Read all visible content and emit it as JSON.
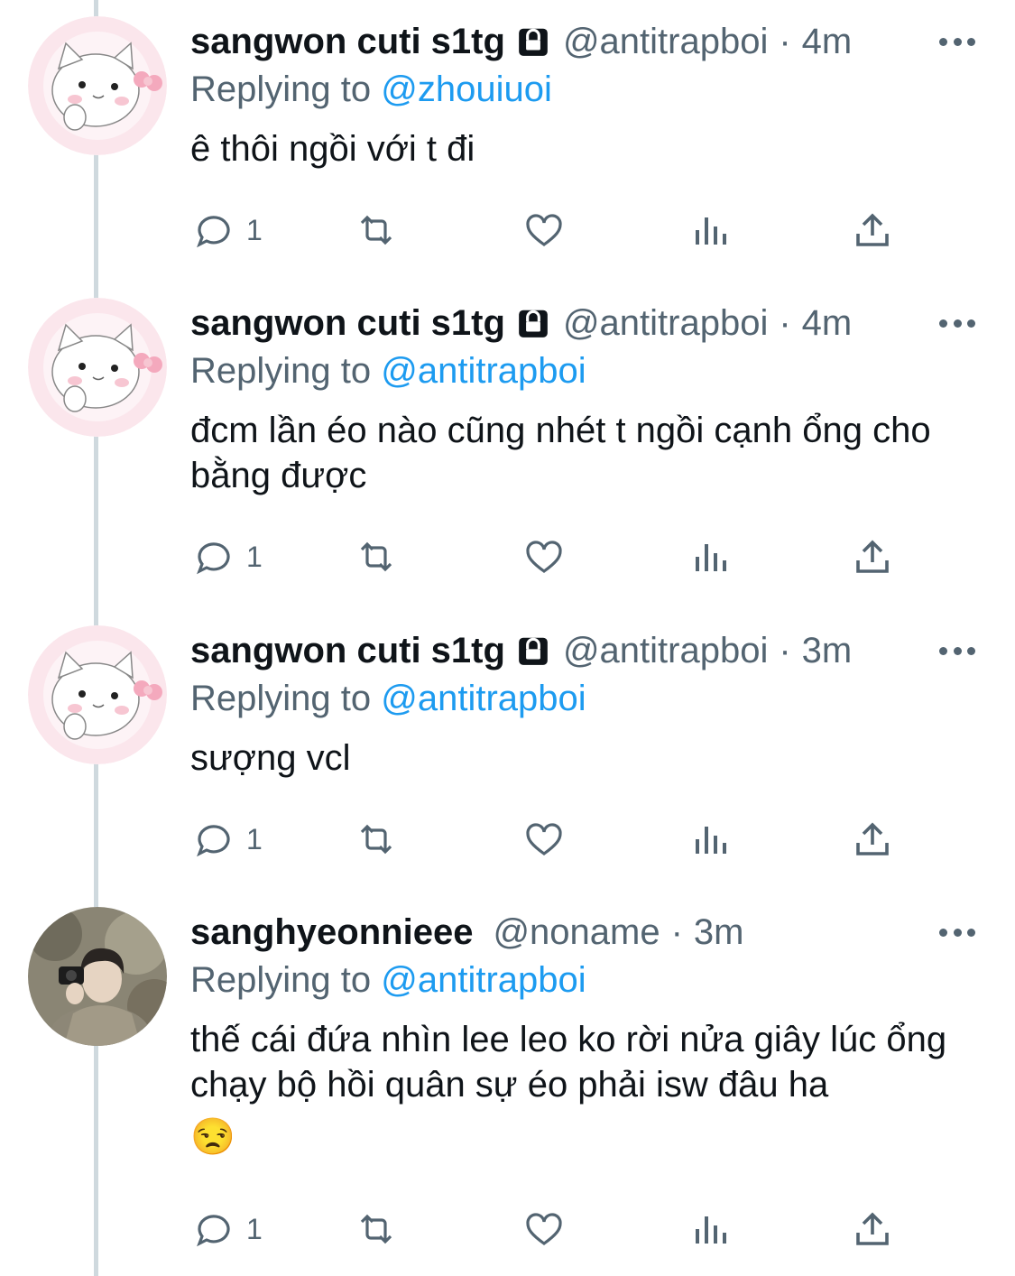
{
  "replying_prefix": "Replying to",
  "tweets": [
    {
      "name": "sangwon cuti s1tg",
      "protected": true,
      "handle": "@antitrapboi",
      "separator": "·",
      "time": "4m",
      "reply_to": "@zhouiuoi",
      "text": "ê thôi ngồi với t đi",
      "reply_count": "1",
      "avatar": "hello-kitty-avatar"
    },
    {
      "name": "sangwon cuti s1tg",
      "protected": true,
      "handle": "@antitrapboi",
      "separator": "·",
      "time": "4m",
      "reply_to": "@antitrapboi",
      "text": "đcm lần éo nào cũng nhét t ngồi cạnh ổng cho bằng được",
      "reply_count": "1",
      "avatar": "hello-kitty-avatar"
    },
    {
      "name": "sangwon cuti s1tg",
      "protected": true,
      "handle": "@antitrapboi",
      "separator": "·",
      "time": "3m",
      "reply_to": "@antitrapboi",
      "text": "sượng vcl",
      "reply_count": "1",
      "avatar": "hello-kitty-avatar"
    },
    {
      "name": "sanghyeonnieee",
      "protected": false,
      "handle": "@noname",
      "separator": "·",
      "time": "3m",
      "reply_to": "@antitrapboi",
      "text": "thế cái đứa nhìn lee leo ko rời nửa giây lúc ổng chạy bộ hồi quân sự éo phải isw đâu ha",
      "emoji": "😒",
      "reply_count": "1",
      "avatar": "person-photo-avatar"
    }
  ],
  "icons": [
    "reply-icon",
    "retweet-icon",
    "like-icon",
    "views-icon",
    "share-icon",
    "lock-icon",
    "more-icon"
  ],
  "colors": {
    "link": "#1d9bf0",
    "secondary": "#536471",
    "text": "#0f1419",
    "thread_line": "#cfd9de"
  }
}
